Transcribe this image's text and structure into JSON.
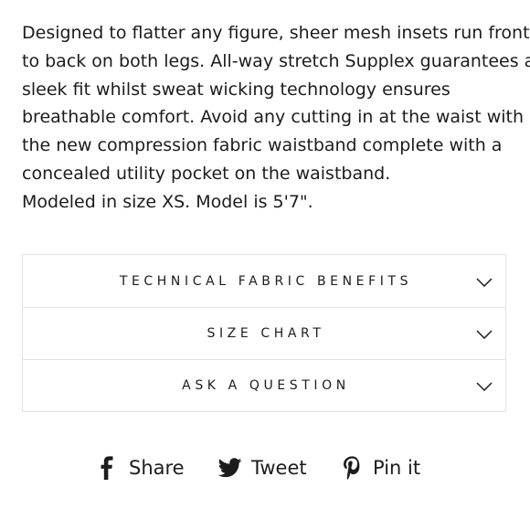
{
  "description": {
    "lines": [
      "Designed to flatter any figure, sheer mesh insets run front",
      "to back on both legs. All-way stretch Supplex guarantees a",
      "sleek fit whilst sweat wicking technology ensures",
      "breathable comfort. Avoid any cutting in at the waist with",
      "the new compression fabric waistband complete with a",
      "concealed utility pocket on the waistband.",
      "Modeled in size XS. Model is 5'7\"."
    ]
  },
  "accordion": {
    "items": [
      {
        "label": "TECHNICAL FABRIC BENEFITS",
        "icon": "chevron-down-icon"
      },
      {
        "label": "SIZE CHART",
        "icon": "chevron-down-icon"
      },
      {
        "label": "ASK A QUESTION",
        "icon": "chevron-down-icon"
      }
    ]
  },
  "social": {
    "share_label": "Share",
    "share_icon": "facebook-icon",
    "tweet_label": "Tweet",
    "tweet_icon": "twitter-icon",
    "pin_label": "Pin it",
    "pin_icon": "pinterest-icon"
  },
  "colors": {
    "text": "#1c1c1c",
    "border": "#e3e3e3",
    "background": "#ffffff"
  }
}
